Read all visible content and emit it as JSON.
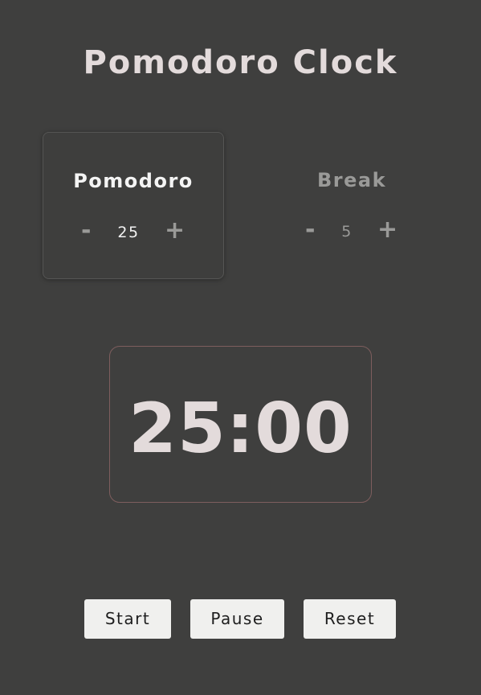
{
  "app": {
    "title": "Pomodoro Clock"
  },
  "pomodoro": {
    "label": "Pomodoro",
    "value": "25",
    "minus": "-",
    "plus": "+"
  },
  "break": {
    "label": "Break",
    "value": "5",
    "minus": "-",
    "plus": "+"
  },
  "timer": {
    "display": "25:00"
  },
  "controls": {
    "start_label": "Start",
    "pause_label": "Pause",
    "reset_label": "Reset"
  },
  "colors": {
    "background": "#3f3f3e",
    "title": "#e3dbdb",
    "active_label": "#f4f4f4",
    "inactive_label": "#9a9a98",
    "timer_border": "#7e5e5e",
    "button_bg": "#f0f0ee"
  }
}
